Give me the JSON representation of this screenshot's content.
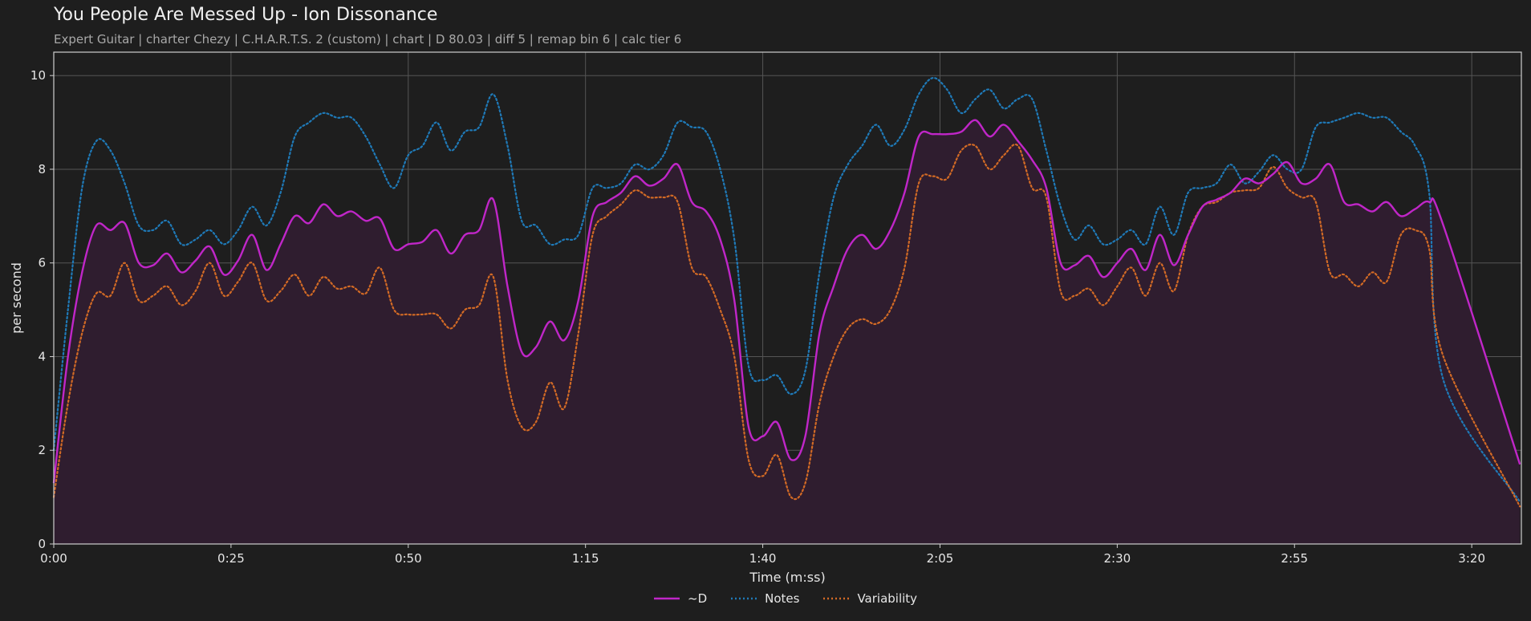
{
  "title": "You People Are Messed Up - Ion Dissonance",
  "subtitle": "Expert Guitar  |  charter Chezy  |  C.H.A.R.T.S. 2 (custom)  |  chart  |  D 80.03  |  diff 5  |  remap bin 6  |  calc tier 6",
  "colors": {
    "background": "#1e1e1e",
    "d": "#c026c8",
    "notes": "#1f7ab8",
    "variability": "#d26a25",
    "fill": "#2f1d2f",
    "grid": "#555555",
    "axis": "#cfcfcf"
  },
  "chart_data": {
    "type": "line",
    "xlabel": "Time (m:ss)",
    "ylabel": "per second",
    "xlim": [
      0,
      207
    ],
    "ylim": [
      0,
      10.5
    ],
    "xticks": [
      0,
      25,
      50,
      75,
      100,
      125,
      150,
      175,
      200
    ],
    "xtick_labels": [
      "0:00",
      "0:25",
      "0:50",
      "1:15",
      "1:40",
      "2:05",
      "2:30",
      "2:55",
      "3:20"
    ],
    "yticks": [
      0,
      2,
      4,
      6,
      8,
      10
    ],
    "grid": true,
    "legend_position": "bottom-center",
    "x": [
      0,
      2,
      4,
      6,
      8,
      10,
      12,
      14,
      16,
      18,
      20,
      22,
      24,
      26,
      28,
      30,
      32,
      34,
      36,
      38,
      40,
      42,
      44,
      46,
      48,
      50,
      52,
      54,
      56,
      58,
      60,
      62,
      64,
      66,
      68,
      70,
      72,
      74,
      76,
      78,
      80,
      82,
      84,
      86,
      88,
      90,
      92,
      94,
      96,
      98,
      100,
      102,
      104,
      106,
      108,
      110,
      112,
      114,
      116,
      118,
      120,
      122,
      124,
      126,
      128,
      130,
      132,
      134,
      136,
      138,
      140,
      142,
      144,
      146,
      148,
      150,
      152,
      154,
      156,
      158,
      160,
      162,
      164,
      166,
      168,
      170,
      172,
      174,
      176,
      178,
      180,
      182,
      184,
      186,
      188,
      190,
      192,
      194,
      196,
      198,
      200,
      202,
      204,
      206
    ],
    "series": [
      {
        "name": "~D",
        "style": "solid",
        "values": [
          1.3,
          4.0,
          5.8,
          6.8,
          6.7,
          6.85,
          6.0,
          5.95,
          6.2,
          5.8,
          6.05,
          6.35,
          5.75,
          6.05,
          6.6,
          5.85,
          6.4,
          7.0,
          6.85,
          7.25,
          7.0,
          7.1,
          6.9,
          6.95,
          6.3,
          6.4,
          6.45,
          6.7,
          6.2,
          6.6,
          6.7,
          7.35,
          5.5,
          4.1,
          4.2,
          4.75,
          4.35,
          5.2,
          7.0,
          7.3,
          7.5,
          7.85,
          7.65,
          7.8,
          8.1,
          7.3,
          7.1,
          6.5,
          5.2,
          2.5,
          2.3,
          2.6,
          1.8,
          2.3,
          4.5,
          5.5,
          6.3,
          6.6,
          6.3,
          6.7,
          7.5,
          8.7,
          8.75,
          8.75,
          8.8,
          9.05,
          8.7,
          8.95,
          8.6,
          8.2,
          7.6,
          6.0,
          5.95,
          6.15,
          5.7,
          6.0,
          6.3,
          5.85,
          6.6,
          5.95,
          6.6,
          7.2,
          7.35,
          7.5,
          7.8,
          7.7,
          7.9,
          8.15,
          7.7,
          7.8,
          8.1,
          7.3,
          7.25,
          7.1,
          7.3,
          7.0,
          7.15,
          7.3,
          6.8,
          1.7
        ],
        "x_trunc": 99
      },
      {
        "name": "Notes",
        "style": "dotted",
        "values": [
          2.0,
          5.0,
          7.6,
          8.6,
          8.4,
          7.7,
          6.8,
          6.7,
          6.9,
          6.4,
          6.5,
          6.7,
          6.4,
          6.7,
          7.2,
          6.8,
          7.5,
          8.7,
          9.0,
          9.2,
          9.1,
          9.1,
          8.7,
          8.1,
          7.6,
          8.3,
          8.5,
          9.0,
          8.4,
          8.8,
          8.9,
          9.6,
          8.5,
          6.9,
          6.8,
          6.4,
          6.5,
          6.6,
          7.6,
          7.6,
          7.7,
          8.1,
          8.0,
          8.3,
          9.0,
          8.9,
          8.8,
          8.0,
          6.5,
          3.8,
          3.5,
          3.6,
          3.2,
          3.7,
          5.8,
          7.4,
          8.1,
          8.5,
          8.95,
          8.5,
          8.85,
          9.6,
          9.95,
          9.7,
          9.2,
          9.5,
          9.7,
          9.3,
          9.5,
          9.5,
          8.4,
          7.2,
          6.5,
          6.8,
          6.4,
          6.5,
          6.7,
          6.4,
          7.2,
          6.6,
          7.5,
          7.6,
          7.7,
          8.1,
          7.7,
          7.95,
          8.3,
          8.0,
          8.0,
          8.9,
          9.0,
          9.1,
          9.2,
          9.1,
          9.1,
          8.8,
          8.5,
          7.5,
          3.5,
          0.9
        ],
        "x_trunc": 99
      },
      {
        "name": "Variability",
        "style": "dotted",
        "values": [
          1.0,
          3.0,
          4.5,
          5.35,
          5.3,
          6.0,
          5.2,
          5.3,
          5.5,
          5.1,
          5.4,
          6.0,
          5.3,
          5.6,
          6.0,
          5.2,
          5.4,
          5.75,
          5.3,
          5.7,
          5.45,
          5.5,
          5.35,
          5.9,
          5.0,
          4.9,
          4.9,
          4.9,
          4.6,
          5.0,
          5.1,
          5.7,
          3.5,
          2.5,
          2.6,
          3.45,
          2.9,
          4.5,
          6.6,
          7.0,
          7.25,
          7.55,
          7.4,
          7.4,
          7.3,
          5.9,
          5.7,
          5.0,
          4.0,
          1.8,
          1.45,
          1.9,
          1.0,
          1.3,
          3.0,
          4.0,
          4.6,
          4.8,
          4.7,
          5.0,
          5.9,
          7.7,
          7.85,
          7.8,
          8.4,
          8.5,
          8.0,
          8.3,
          8.5,
          7.6,
          7.4,
          5.4,
          5.3,
          5.45,
          5.1,
          5.5,
          5.9,
          5.3,
          6.0,
          5.4,
          6.6,
          7.2,
          7.3,
          7.5,
          7.55,
          7.6,
          8.05,
          7.6,
          7.4,
          7.3,
          5.8,
          5.75,
          5.5,
          5.8,
          5.6,
          6.6,
          6.7,
          6.3,
          4.0,
          0.8
        ],
        "x_trunc": 99
      }
    ]
  }
}
